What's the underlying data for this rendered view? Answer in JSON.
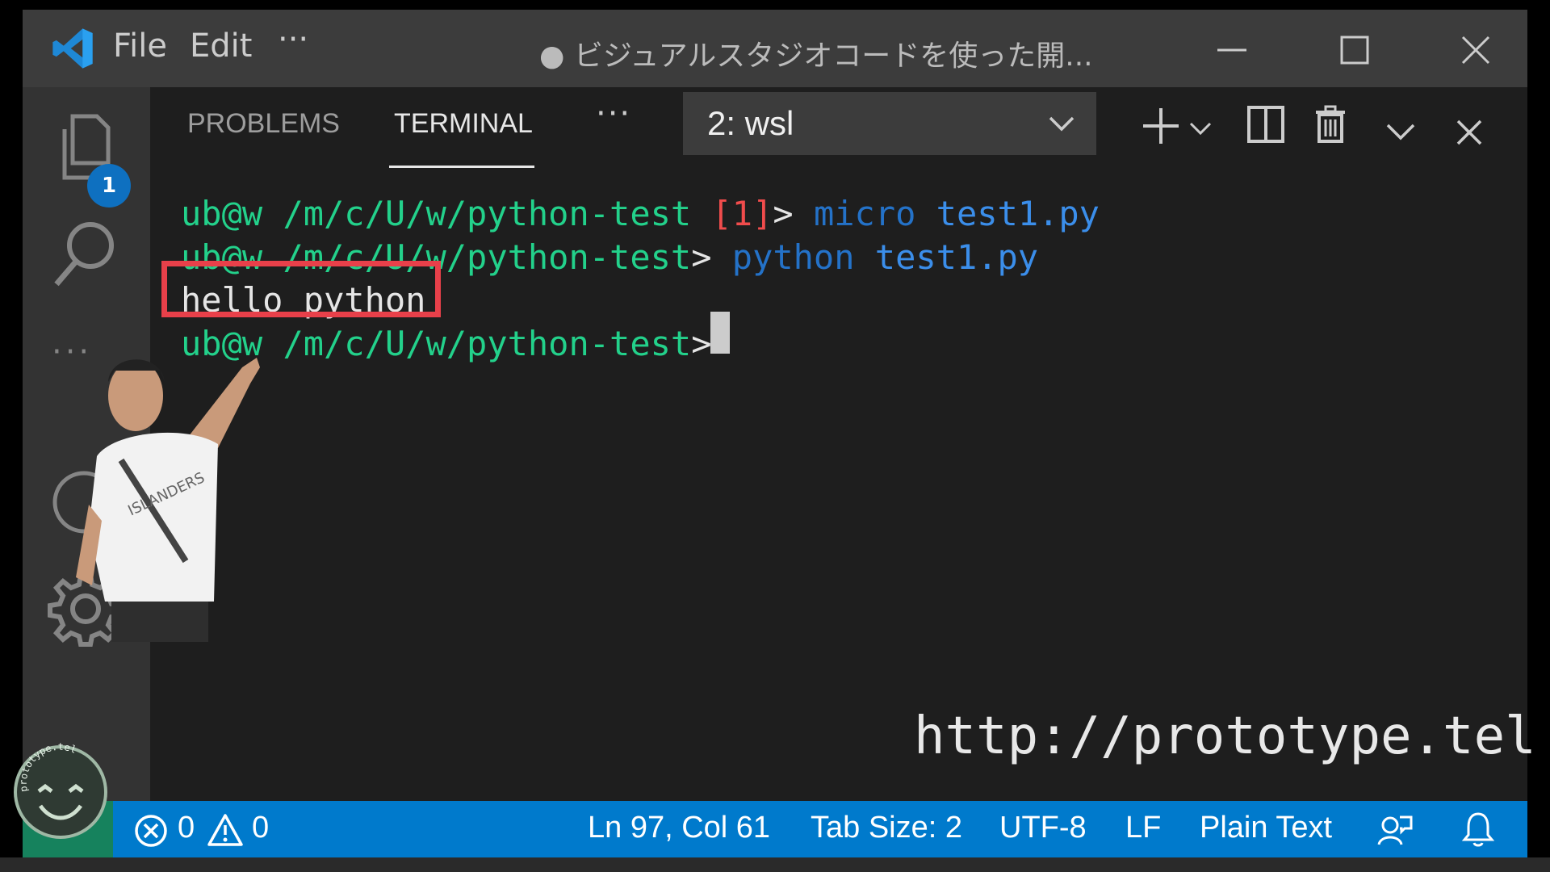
{
  "titlebar": {
    "menu": [
      "File",
      "Edit",
      "···"
    ],
    "title": "● ビジュアルスタジオコードを使った開..."
  },
  "activitybar": {
    "explorer_badge": "1"
  },
  "panel": {
    "tabs": [
      "PROBLEMS",
      "TERMINAL"
    ],
    "active_tab": "TERMINAL",
    "more": "···",
    "terminal_select": "2: wsl"
  },
  "terminal": {
    "lines": [
      {
        "user": "ub@w",
        "path": "/m/c/U/w/python-test",
        "status": "[1]",
        "prompt": ">",
        "cmd": "micro",
        "arg": "test1.py"
      },
      {
        "user": "ub@w",
        "path": "/m/c/U/w/python-test",
        "prompt": ">",
        "cmd": "python",
        "arg": "test1.py"
      },
      {
        "output": "hello python"
      },
      {
        "user": "ub@w",
        "path": "/m/c/U/w/python-test",
        "prompt": ">"
      }
    ]
  },
  "watermark": "http://prototype.tel",
  "stamp_text": "prototype.tel",
  "statusbar": {
    "errors": "0",
    "warnings": "0",
    "position": "Ln 97, Col 61",
    "tab_size": "Tab Size: 2",
    "encoding": "UTF-8",
    "eol": "LF",
    "language": "Plain Text"
  },
  "colors": {
    "titlebar": "#3c3c3c",
    "activitybar": "#333333",
    "editor_bg": "#1e1e1e",
    "statusbar": "#007acc",
    "remote": "#16825d",
    "highlight": "#e8404a",
    "prompt_green": "#23d18b",
    "cmd_blue": "#2472c8",
    "arg_blue": "#3b8eea"
  }
}
